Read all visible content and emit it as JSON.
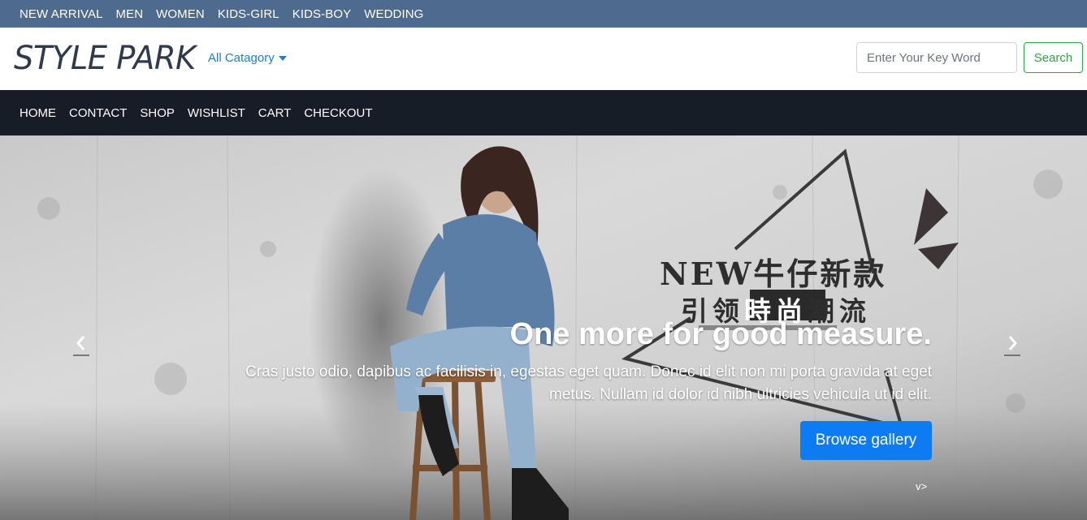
{
  "top_nav": {
    "items": [
      "NEW ARRIVAL",
      "MEN",
      "WOMEN",
      "KIDS-GIRL",
      "KIDS-BOY",
      "WEDDING"
    ]
  },
  "brand": {
    "logo": "STYLE PARK",
    "category_dropdown": "All Catagory",
    "search_placeholder": "Enter Your Key Word",
    "search_button": "Search"
  },
  "main_nav": {
    "items": [
      "HOME",
      "CONTACT",
      "SHOP",
      "WISHLIST",
      "CART",
      "CHECKOUT"
    ]
  },
  "carousel": {
    "banner_line1": "NEW牛仔新款",
    "banner_line2_a": "引领",
    "banner_line2_b": "時尚",
    "banner_line2_c": "潮流",
    "title": "One more for good measure.",
    "text": "Cras justo odio, dapibus ac facilisis in, egestas eget quam. Donec id elit non mi porta gravida at eget metus. Nullam id dolor id nibh ultricies vehicula ut id elit.",
    "button": "Browse gallery",
    "stray_text": "v>",
    "prev_icon": "chevron-left-icon",
    "next_icon": "chevron-right-icon"
  },
  "colors": {
    "top_nav_bg": "#4e6a8d",
    "main_nav_bg": "#161d27",
    "accent_link": "#1c7fd1",
    "search_green": "#28a745",
    "primary_button": "#0d7cf2"
  }
}
